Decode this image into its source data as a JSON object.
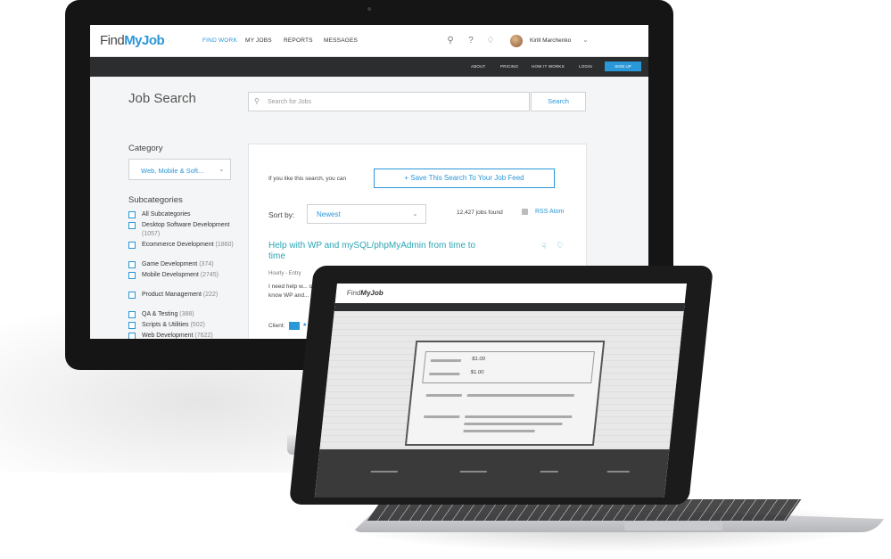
{
  "header": {
    "logo_prefix": "Find",
    "logo_brand": "MyJob",
    "nav": [
      "FIND WORK",
      "MY JOBS",
      "REPORTS",
      "MESSAGES"
    ],
    "user_name": "Kirill Marchenko",
    "icons": [
      "search-icon",
      "help-icon",
      "bell-icon",
      "chevron-down-icon"
    ]
  },
  "subnav": {
    "links": [
      "ABOUT",
      "PRICING",
      "HOW IT WORKS",
      "LOGIN"
    ],
    "signup": "SIGN UP"
  },
  "search": {
    "title": "Job Search",
    "placeholder": "Search for Jobs",
    "button": "Search"
  },
  "sidebar": {
    "category_heading": "Category",
    "category_value": "Web, Mobile & Soft...",
    "subcategories_heading": "Subcategories",
    "subcategories": [
      {
        "label": "All Subcategories",
        "count": ""
      },
      {
        "label": "Desktop Software Development",
        "count": "(1057)"
      },
      {
        "label": "Ecommerce Development",
        "count": "(1860)"
      },
      {
        "label": "Game Development",
        "count": "(374)"
      },
      {
        "label": "Mobile Development",
        "count": "(2745)"
      },
      {
        "label": "Product Management",
        "count": "(222)"
      },
      {
        "label": "QA & Testing",
        "count": "(388)"
      },
      {
        "label": "Scripts & Utilities",
        "count": "(502)"
      },
      {
        "label": "Web Development",
        "count": "(7622)"
      }
    ]
  },
  "results": {
    "save_hint": "If you like this search, you can",
    "save_button": "+ Save This Search To Your Job Feed",
    "sort_label": "Sort by:",
    "sort_value": "Newest",
    "jobs_found": "12,427 jobs found",
    "rss_label": "RSS Atom",
    "job": {
      "title": "Help with WP and mySQL/phpMyAdmin from time to time",
      "meta": "Hourly - Entry",
      "description": "I need help w... only be a few... know WP and...",
      "client_label": "Client:",
      "stars": "★★★"
    }
  },
  "laptop": {
    "logo_prefix": "Find",
    "logo_brand": "MyJob",
    "price_a": "$1.00",
    "price_b": "$1.00"
  },
  "colors": {
    "accent": "#2a97d9",
    "job_title": "#2aa5b5",
    "dark_bar": "#2c2d2f"
  }
}
